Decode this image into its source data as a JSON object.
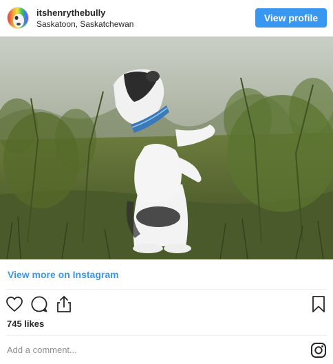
{
  "header": {
    "username": "itshenrythebully",
    "location": "Saskatoon, Saskatchewan",
    "view_profile_label": "View profile"
  },
  "post": {
    "view_more_label": "View more on Instagram",
    "likes": "745 likes",
    "comment_placeholder": "Add a comment..."
  },
  "icons": {
    "like": "heart-icon",
    "comment": "comment-icon",
    "share": "share-icon",
    "save": "bookmark-icon",
    "brand": "instagram-icon"
  },
  "colors": {
    "accent": "#3897f0",
    "text": "#262626",
    "muted": "#8e8e8e"
  }
}
